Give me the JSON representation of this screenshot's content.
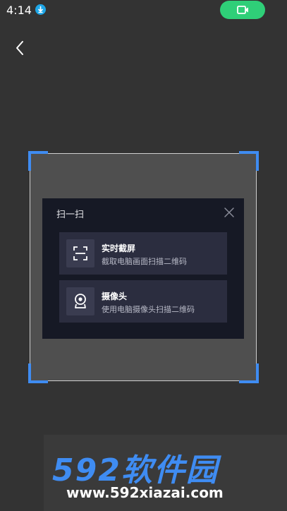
{
  "status_bar": {
    "time": "4:14",
    "download_icon": "download-icon",
    "video_icon": "video-camera-icon",
    "accent_green": "#2fcf78",
    "accent_blue": "#1ea7e8"
  },
  "nav": {
    "back_icon": "chevron-left-icon"
  },
  "scan": {
    "corner_color": "#3f8cf2"
  },
  "dialog": {
    "title": "扫一扫",
    "close_icon": "close-icon",
    "options": [
      {
        "title": "实时截屏",
        "subtitle": "截取电脑画面扫描二维码",
        "icon": "screenshot-scan-icon"
      },
      {
        "title": "摄像头",
        "subtitle": "使用电脑摄像头扫描二维码",
        "icon": "webcam-icon"
      }
    ]
  },
  "watermark": {
    "logo": "592软件园",
    "url": "www.592xiazai.com"
  }
}
